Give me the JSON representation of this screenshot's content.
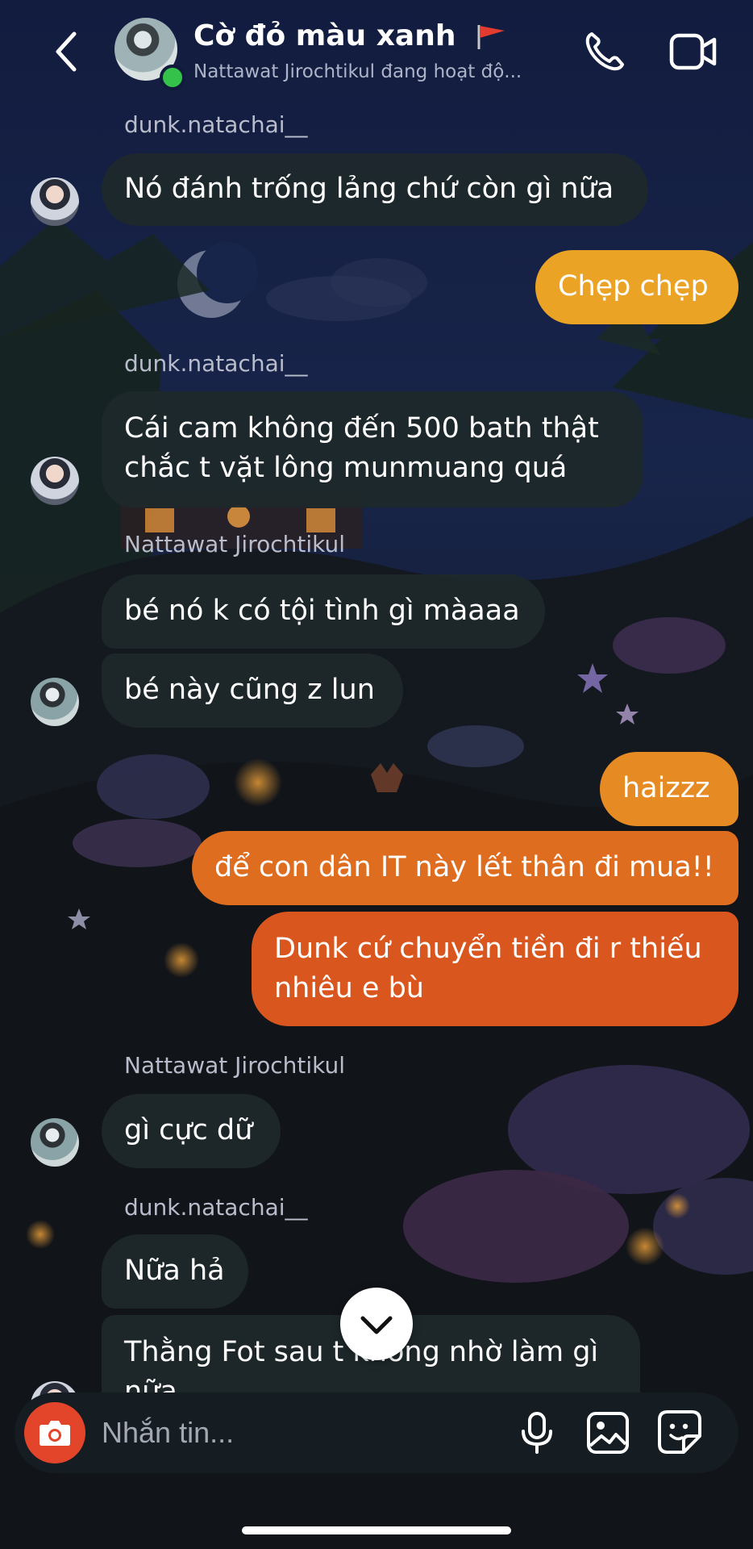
{
  "header": {
    "title": "Cờ đỏ màu xanh",
    "subtitle": "Nattawat Jirochtikul đang hoạt độ...",
    "back_icon": "chevron-left-icon",
    "call_icon": "phone-icon",
    "video_icon": "video-camera-icon"
  },
  "messages": [
    {
      "sender": "dunk.natachai__",
      "text": "Nó đánh trống lảng chứ còn gì nữa"
    },
    {
      "text": "Chẹp chẹp"
    },
    {
      "sender": "dunk.natachai__",
      "lines": [
        "Cái cam không đến 500 bath thật",
        "chắc t vặt lông munmuang quá"
      ]
    },
    {
      "sender": "Nattawat Jirochtikul",
      "text": "bé nó k có tội tình gì màaaa"
    },
    {
      "text": "bé này cũng z lun"
    },
    {
      "text": "haizzz"
    },
    {
      "text": "để con dân IT này lết thân đi mua!!"
    },
    {
      "lines": [
        "Dunk cứ chuyển tiền đi r thiếu",
        "nhiêu e bù"
      ]
    },
    {
      "sender": "Nattawat Jirochtikul",
      "text": "gì cực dữ"
    },
    {
      "sender": "dunk.natachai__",
      "text": "Nữa hả"
    },
    {
      "lines": [
        "Thằng Fot sau t không nhờ làm gì",
        "nữa"
      ]
    }
  ],
  "composer": {
    "placeholder": "Nhắn tin...",
    "icons": [
      "camera-icon",
      "microphone-icon",
      "gallery-icon",
      "sticker-icon"
    ]
  },
  "colors": {
    "outgoing_top": "#eba326",
    "outgoing_bottom": "#d9561e",
    "incoming": "#1e282c",
    "online": "#35c24a",
    "camera_button": "#e2452a"
  }
}
